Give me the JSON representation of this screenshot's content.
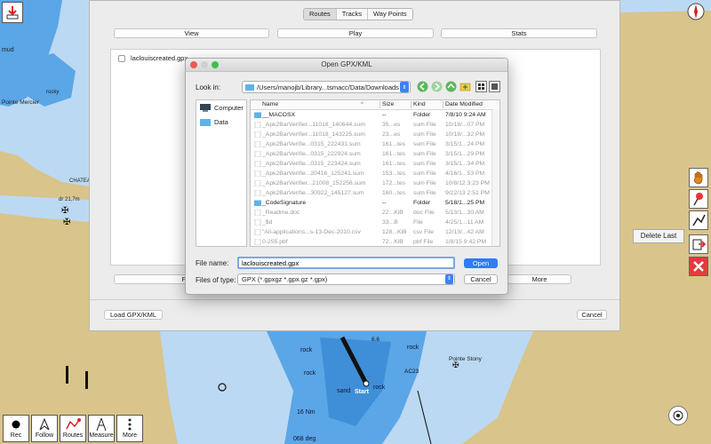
{
  "colors": {
    "land": "#d9c48b",
    "shallow_water": "#5aa6e6",
    "deep_water": "#bcd9f3",
    "accent_blue": "#2f7cf6",
    "folder_blue": "#5fb2e8",
    "close_red": "#e33b3b"
  },
  "chart_labels": {
    "mud": "mud",
    "rocky": "rocky",
    "pointe_mercier": "Pointe Mercier",
    "chatea": "CHATEA",
    "rock_a": "rock",
    "rock_b": "rock",
    "rock_c": "rock",
    "rock_d": "rock",
    "sand": "sand",
    "start": "Start",
    "nm16": "16 Nm",
    "pointe_stony": "Pointe Stony",
    "dr": "dr 21,7m",
    "deg068": "068 deg",
    "val66": "6.6",
    "ac23": "AC23"
  },
  "routes_panel": {
    "tabs": [
      "Routes",
      "Tracks",
      "Way Points"
    ],
    "view_label": "View",
    "play_label": "Play",
    "stats_label": "Stats",
    "route_item": "laclouiscreated.gpx",
    "follow_label": "Follow",
    "more_label": "More",
    "load_label": "Load GPX/KML",
    "cancel_label": "Cancel"
  },
  "right_tools": {
    "delete_last_label": "Delete Last",
    "icons": [
      "hand-icon",
      "pin-icon",
      "route-line-icon",
      "export-icon",
      "close-icon"
    ]
  },
  "toolbar": {
    "rec": "Rec",
    "follow": "Follow",
    "routes": "Routes",
    "measure": "Measure",
    "more": "More"
  },
  "dialog": {
    "title": "Open GPX/KML",
    "look_in_label": "Look in:",
    "path": "/Users/manojb/Library...tsmacc/Data/Downloads",
    "sidebar": [
      "Computer",
      "Data"
    ],
    "columns": [
      "Name",
      "Size",
      "Kind",
      "Date Modified"
    ],
    "files": [
      {
        "name": "__MACOSX",
        "size": "--",
        "kind": "Folder",
        "date": "7/8/10 9:24 AM",
        "folder": true,
        "dim": false
      },
      {
        "name": "_Apk2BarVerifier...11018_140644.sum",
        "size": "35...es",
        "kind": "sum File",
        "date": "10/18/...07 PM",
        "folder": false,
        "dim": true
      },
      {
        "name": "_Apk2BarVerifier...11018_143225.sum",
        "size": "23...es",
        "kind": "sum File",
        "date": "10/18/...32 PM",
        "folder": false,
        "dim": true
      },
      {
        "name": "_Apk2BarVerifie...0315_222431.sum",
        "size": "161...tes",
        "kind": "sum File",
        "date": "3/15/1...24 PM",
        "folder": false,
        "dim": true
      },
      {
        "name": "_Apk2BarVerifie...0315_222924.sum",
        "size": "161...tes",
        "kind": "sum File",
        "date": "3/15/1...29 PM",
        "folder": false,
        "dim": true
      },
      {
        "name": "_Apk2BarVerifie...0315_223424.sum",
        "size": "161...tes",
        "kind": "sum File",
        "date": "3/15/1...34 PM",
        "folder": false,
        "dim": true
      },
      {
        "name": "_Apk2BarVerifie...20416_125241.sum",
        "size": "153...tes",
        "kind": "sum File",
        "date": "4/16/1...53 PM",
        "folder": false,
        "dim": true
      },
      {
        "name": "_Apk2BarVerifier...21008_152256.sum",
        "size": "172...tes",
        "kind": "sum File",
        "date": "10/8/12 3:23 PM",
        "folder": false,
        "dim": true
      },
      {
        "name": "_Apk2BarVerifie...30922_145127.sum",
        "size": "160...tes",
        "kind": "sum File",
        "date": "9/22/13 2:51 PM",
        "folder": false,
        "dim": true
      },
      {
        "name": "_CodeSignature",
        "size": "--",
        "kind": "Folder",
        "date": "5/18/1...25 PM",
        "folder": true,
        "dim": false
      },
      {
        "name": "_Readme.doc",
        "size": "22...KiB",
        "kind": "doc File",
        "date": "5/13/1...30 AM",
        "folder": false,
        "dim": true
      },
      {
        "name": "_$d",
        "size": "33...B",
        "kind": "File",
        "date": "4/25/1...11 AM",
        "folder": false,
        "dim": true
      },
      {
        "name": "\"All-applications...s-13-Dec-2010.csv",
        "size": "128...KiB",
        "kind": "csv File",
        "date": "12/13/...42 AM",
        "folder": false,
        "dim": true
      },
      {
        "name": "0-255.pbf",
        "size": "72...KiB",
        "kind": "pbf File",
        "date": "1/8/15 9:42 PM",
        "folder": false,
        "dim": true
      }
    ],
    "file_name_label": "File name:",
    "file_name_value": "laclouiscreated.gpx",
    "open_label": "Open",
    "files_of_type_label": "Files of type:",
    "files_of_type_value": "GPX (*.gpxgz *.gpx.gz *.gpx)",
    "cancel_label": "Cancel"
  }
}
